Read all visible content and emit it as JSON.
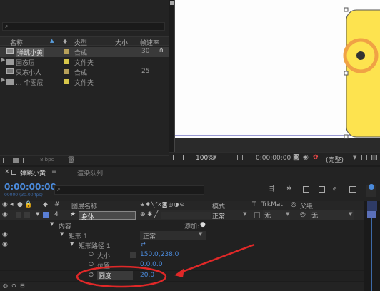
{
  "project": {
    "search_placeholder": "",
    "columns": {
      "name": "名称",
      "type": "类型",
      "size": "大小",
      "fps": "帧速率"
    },
    "items": [
      {
        "name": "弹跳小黄",
        "type": "合成",
        "fps": "30",
        "selected": true
      },
      {
        "name": "固态层",
        "type": "文件夹",
        "fps": ""
      },
      {
        "name": "果冻小人",
        "type": "合成",
        "fps": "25"
      },
      {
        "name": "... 个图层",
        "type": "文件夹",
        "fps": ""
      }
    ],
    "footer_bpc": "8 bpc"
  },
  "viewer": {
    "zoom": "100%",
    "timecode": "0:00:00:00",
    "quality": "(完整)"
  },
  "timeline": {
    "tab_comp": "弹跳小黄",
    "tab_queue": "渲染队列",
    "timecode": "0:00:00:00",
    "timecode_sub": "00000 (30.00 fps)",
    "search_placeholder": "",
    "columns": {
      "layer_name": "图层名称",
      "mode": "模式",
      "t": "T",
      "trkmat": "TrkMat",
      "parent": "父级"
    },
    "layer": {
      "index": "4",
      "name": "身体",
      "mode": "正常",
      "trkmat": "无",
      "parent": "无"
    },
    "rows": {
      "contents": "内容",
      "add": "添加:",
      "rect": "矩形 1",
      "rect_mode": "正常",
      "rect_path": "矩形路径 1",
      "size_label": "大小",
      "size_value": "150.0,238.0",
      "pos_label": "位置",
      "pos_value": "0.0,0.0",
      "round_label": "圆度",
      "round_value": "20.0"
    }
  }
}
